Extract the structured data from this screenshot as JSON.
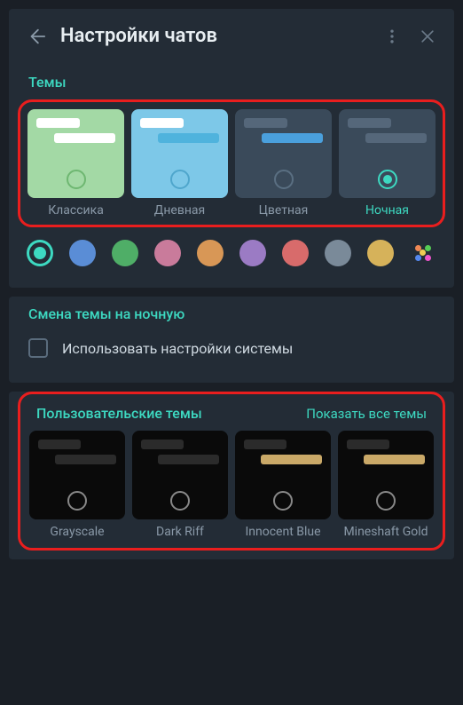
{
  "header": {
    "title": "Настройки чатов"
  },
  "themes": {
    "title": "Темы",
    "items": [
      {
        "label": "Классика"
      },
      {
        "label": "Дневная"
      },
      {
        "label": "Цветная"
      },
      {
        "label": "Ночная"
      }
    ]
  },
  "accents": [
    "#3dd9c1",
    "#5a8dd6",
    "#4fae67",
    "#c97b9b",
    "#d89756",
    "#9b7bc4",
    "#d86b6b",
    "#7a8a99",
    "#d6b25a",
    "multi"
  ],
  "night": {
    "title": "Смена темы на ночную",
    "checkbox_label": "Использовать настройки системы"
  },
  "custom": {
    "title": "Пользовательские темы",
    "show_all": "Показать все темы",
    "items": [
      {
        "label": "Grayscale"
      },
      {
        "label": "Dark Riff"
      },
      {
        "label": "Innocent Blue"
      },
      {
        "label": "Mineshaft Gold"
      }
    ]
  }
}
